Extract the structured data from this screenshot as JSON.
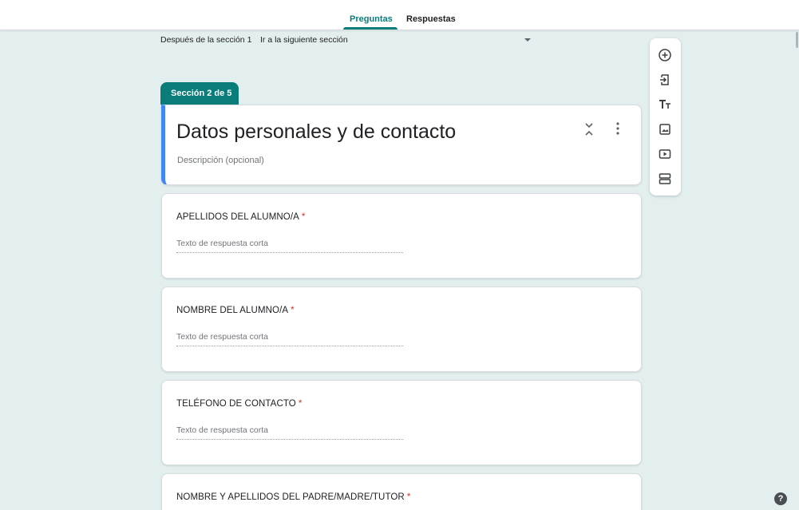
{
  "tabs": {
    "questions": "Preguntas",
    "responses": "Respuestas"
  },
  "after_section": {
    "label": "Después de la sección 1",
    "value": "Ir a la siguiente sección"
  },
  "section": {
    "tag": "Sección 2 de 5",
    "title": "Datos personales y de contacto",
    "description_placeholder": "Descripción (opcional)"
  },
  "questions": [
    {
      "title": "APELLIDOS DEL ALUMNO/A",
      "required": "*",
      "answer_placeholder": "Texto de respuesta corta"
    },
    {
      "title": "NOMBRE DEL ALUMNO/A",
      "required": "*",
      "answer_placeholder": "Texto de respuesta corta"
    },
    {
      "title": "TELÉFONO DE CONTACTO",
      "required": "*",
      "answer_placeholder": "Texto de respuesta corta"
    },
    {
      "title": "NOMBRE Y APELLIDOS DEL PADRE/MADRE/TUTOR",
      "required": "*"
    }
  ],
  "toolbar": {
    "icons": [
      "add-question-icon",
      "import-questions-icon",
      "add-title-icon",
      "add-image-icon",
      "add-video-icon",
      "add-section-icon"
    ]
  },
  "help": {
    "label": "?"
  },
  "colors": {
    "accent": "#0a7d7b",
    "section_border": "#4285f4",
    "background": "#e3efef",
    "required": "#d93025"
  }
}
